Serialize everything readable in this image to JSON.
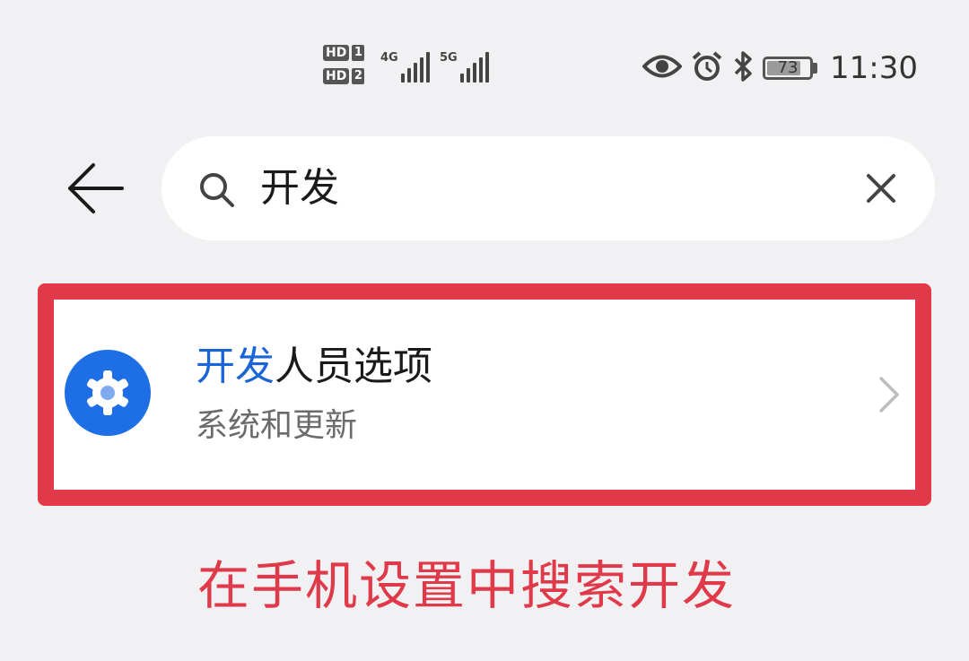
{
  "status_bar": {
    "sim1_badge": "HD",
    "sim1_index": "1",
    "sim2_badge": "HD",
    "sim2_index": "2",
    "network1": "4G",
    "network2": "5G",
    "icons": [
      "eye-icon",
      "alarm-icon",
      "bluetooth-icon"
    ],
    "battery_level": "73",
    "time": "11:30"
  },
  "search": {
    "query": "开发",
    "back_icon": "arrow-left-icon",
    "search_icon": "search-icon",
    "clear_icon": "close-icon"
  },
  "result": {
    "title_highlight": "开发",
    "title_rest": "人员选项",
    "subtitle": "系统和更新",
    "icon": "gear-icon",
    "icon_color": "#1e6fe6",
    "highlight_color": "#1a64d6"
  },
  "annotation": {
    "caption": "在手机设置中搜索开发",
    "color": "#e03a4a"
  }
}
